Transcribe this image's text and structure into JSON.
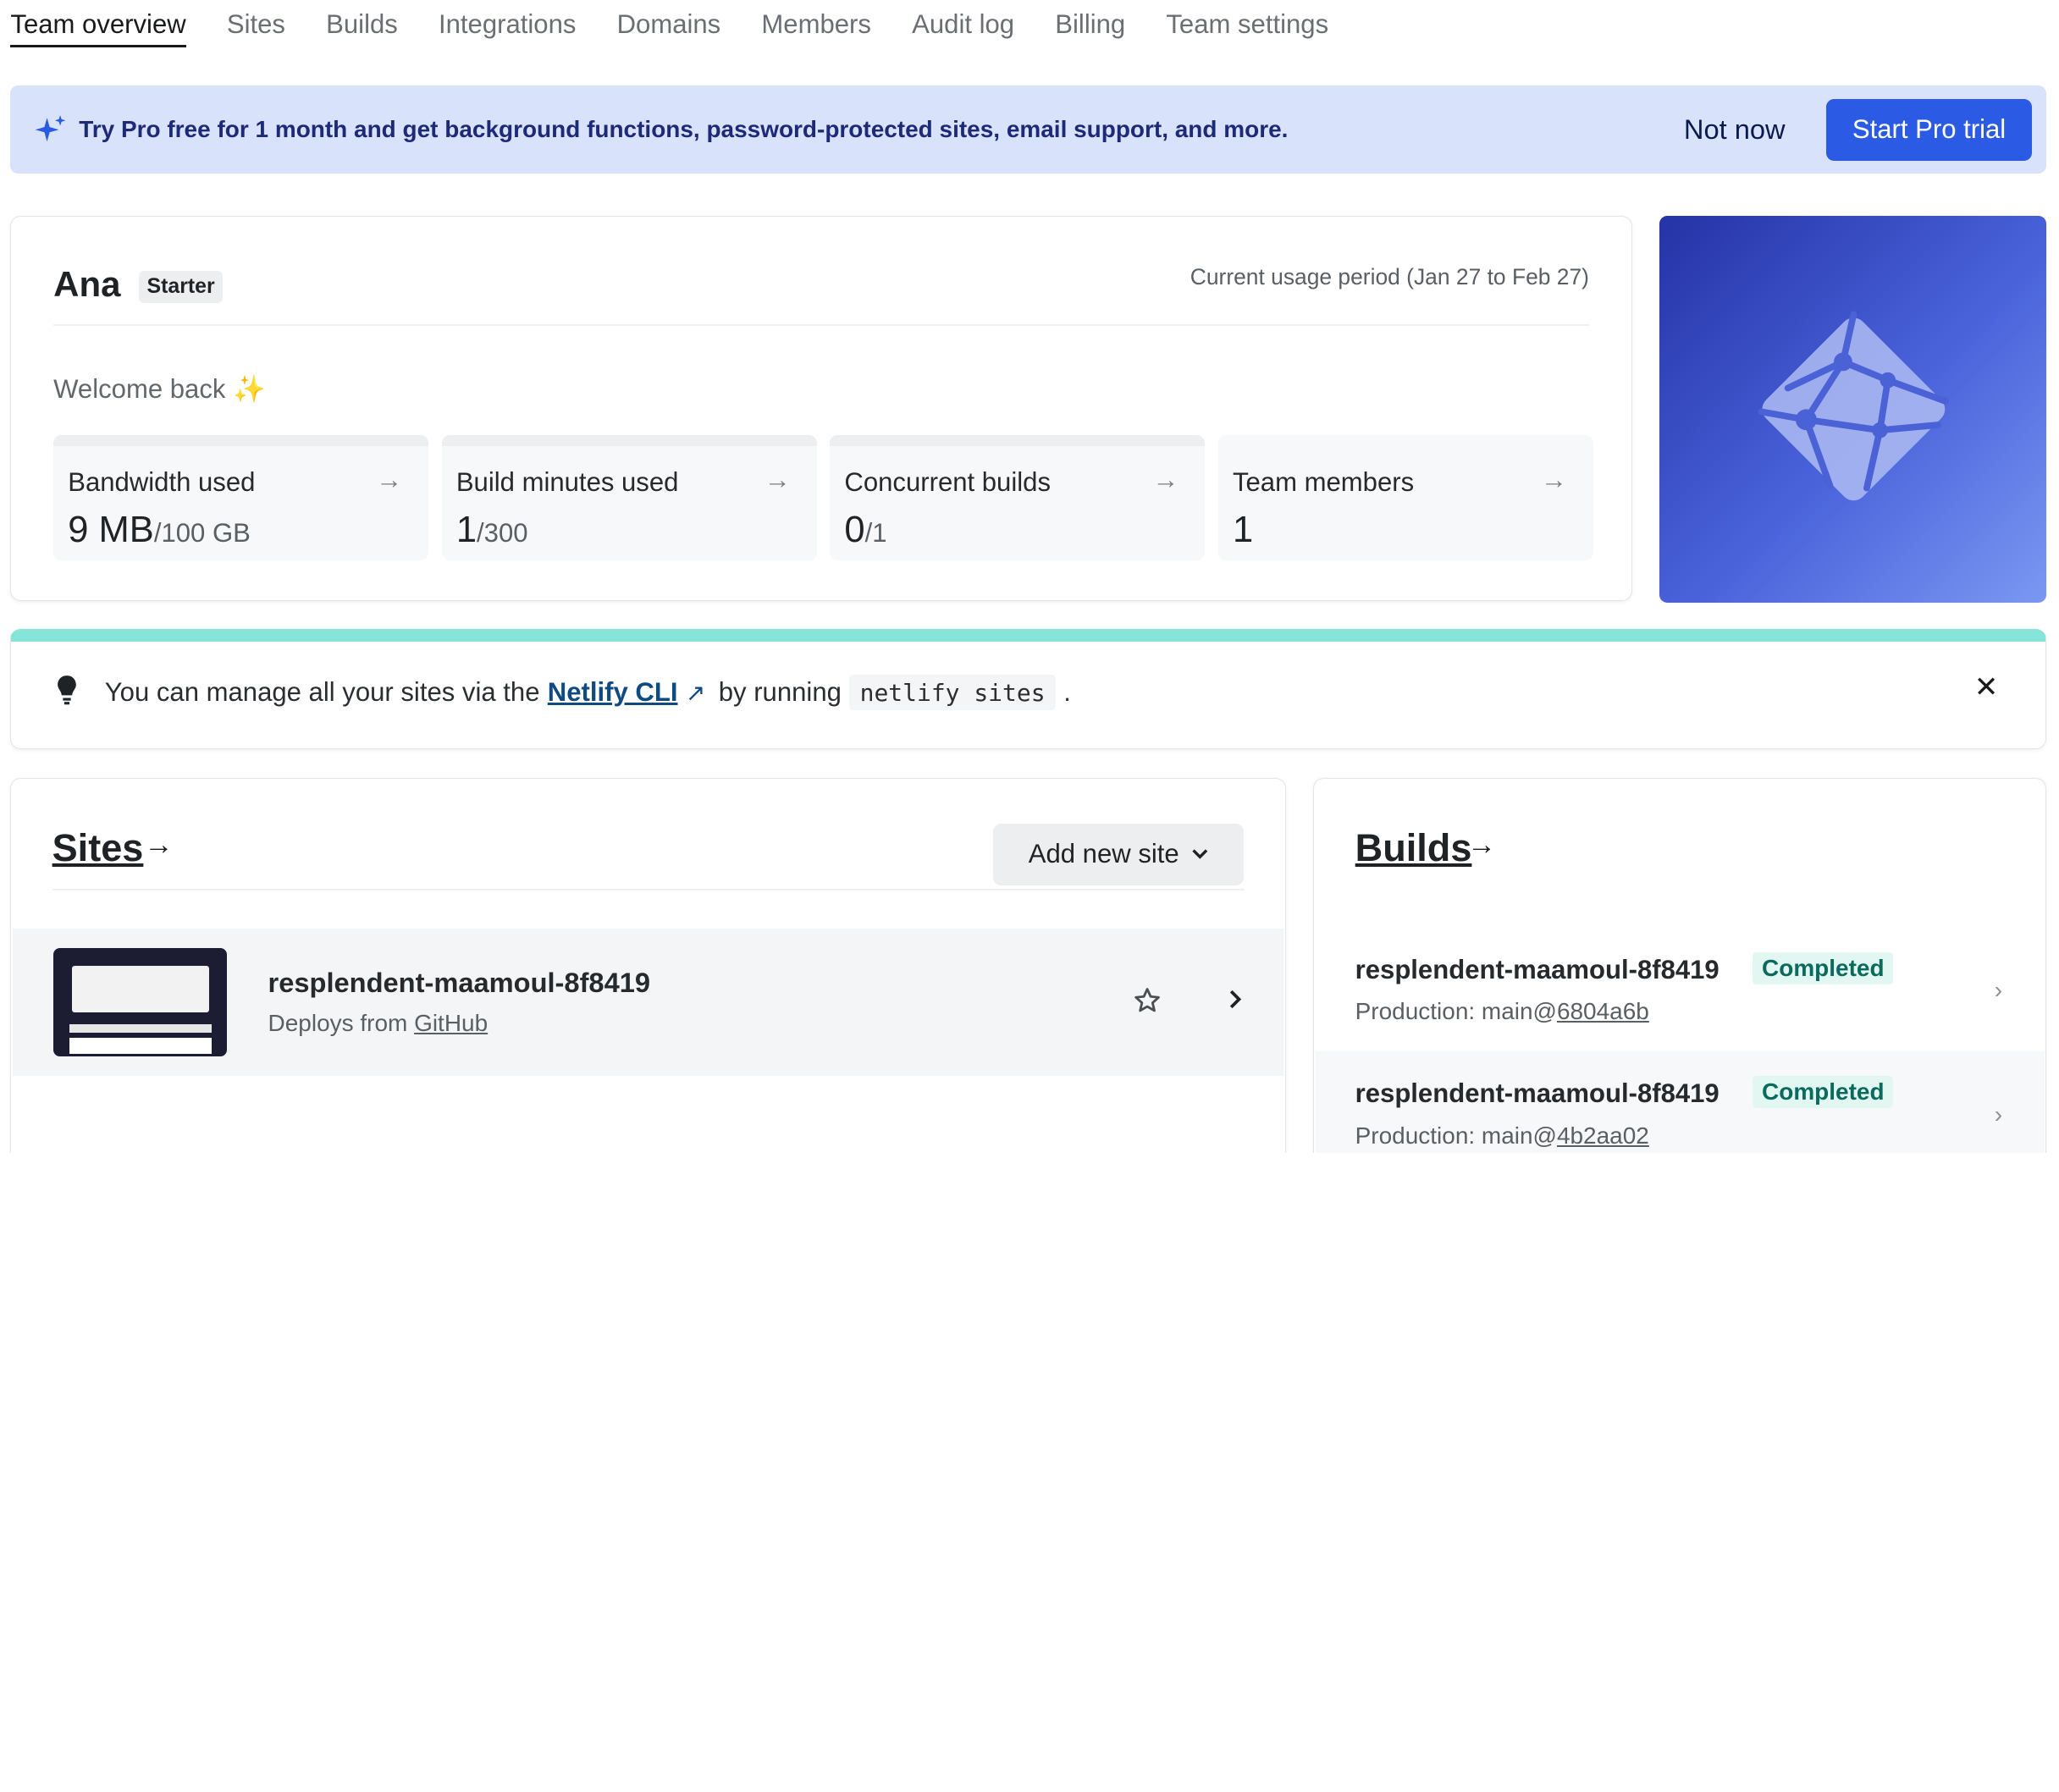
{
  "nav": {
    "tabs": [
      {
        "label": "Team overview"
      },
      {
        "label": "Sites"
      },
      {
        "label": "Builds"
      },
      {
        "label": "Integrations"
      },
      {
        "label": "Domains"
      },
      {
        "label": "Members"
      },
      {
        "label": "Audit log"
      },
      {
        "label": "Billing"
      },
      {
        "label": "Team settings"
      }
    ]
  },
  "banner": {
    "text": "Try Pro free for 1 month and get background functions, password-protected sites, email support, and more.",
    "not_now": "Not now",
    "start_trial": "Start Pro trial"
  },
  "usage": {
    "team_name": "Ana",
    "plan": "Starter",
    "period": "Current usage period (Jan 27 to Feb 27)",
    "welcome": "Welcome back ✨",
    "tiles": [
      {
        "label": "Bandwidth used",
        "value": "9 MB",
        "limit": "/100 GB"
      },
      {
        "label": "Build minutes used",
        "value": "1",
        "limit": "/300"
      },
      {
        "label": "Concurrent builds",
        "value": "0",
        "limit": "/1"
      },
      {
        "label": "Team members",
        "value": "1",
        "limit": ""
      }
    ]
  },
  "tip": {
    "prefix": "You can manage all your sites via the",
    "link": "Netlify CLI",
    "middle": "by running",
    "code": "netlify sites",
    "suffix": "."
  },
  "sites": {
    "title": "Sites",
    "add_button": "Add new site",
    "items": [
      {
        "name": "resplendent-maamoul-8f8419",
        "deploys_prefix": "Deploys from",
        "provider": "GitHub"
      }
    ]
  },
  "builds": {
    "title": "Builds",
    "items": [
      {
        "site": "resplendent-maamoul-8f8419",
        "status": "Completed",
        "context": "Production: main@",
        "commit": "6804a6b"
      },
      {
        "site": "resplendent-maamoul-8f8419",
        "status": "Completed",
        "context": "Production: main@",
        "commit": "4b2aa02"
      }
    ]
  },
  "colors": {
    "accent": "#2b5be4",
    "banner_bg": "#d8e3fb",
    "tip_accent": "#86e5d8",
    "success": "#0a6a5c"
  },
  "icons": [
    "sparkle-icon",
    "arrow-right-icon",
    "netlify-logo",
    "lightbulb-icon",
    "close-icon",
    "chevron-down-icon",
    "star-icon",
    "chevron-right-icon"
  ]
}
